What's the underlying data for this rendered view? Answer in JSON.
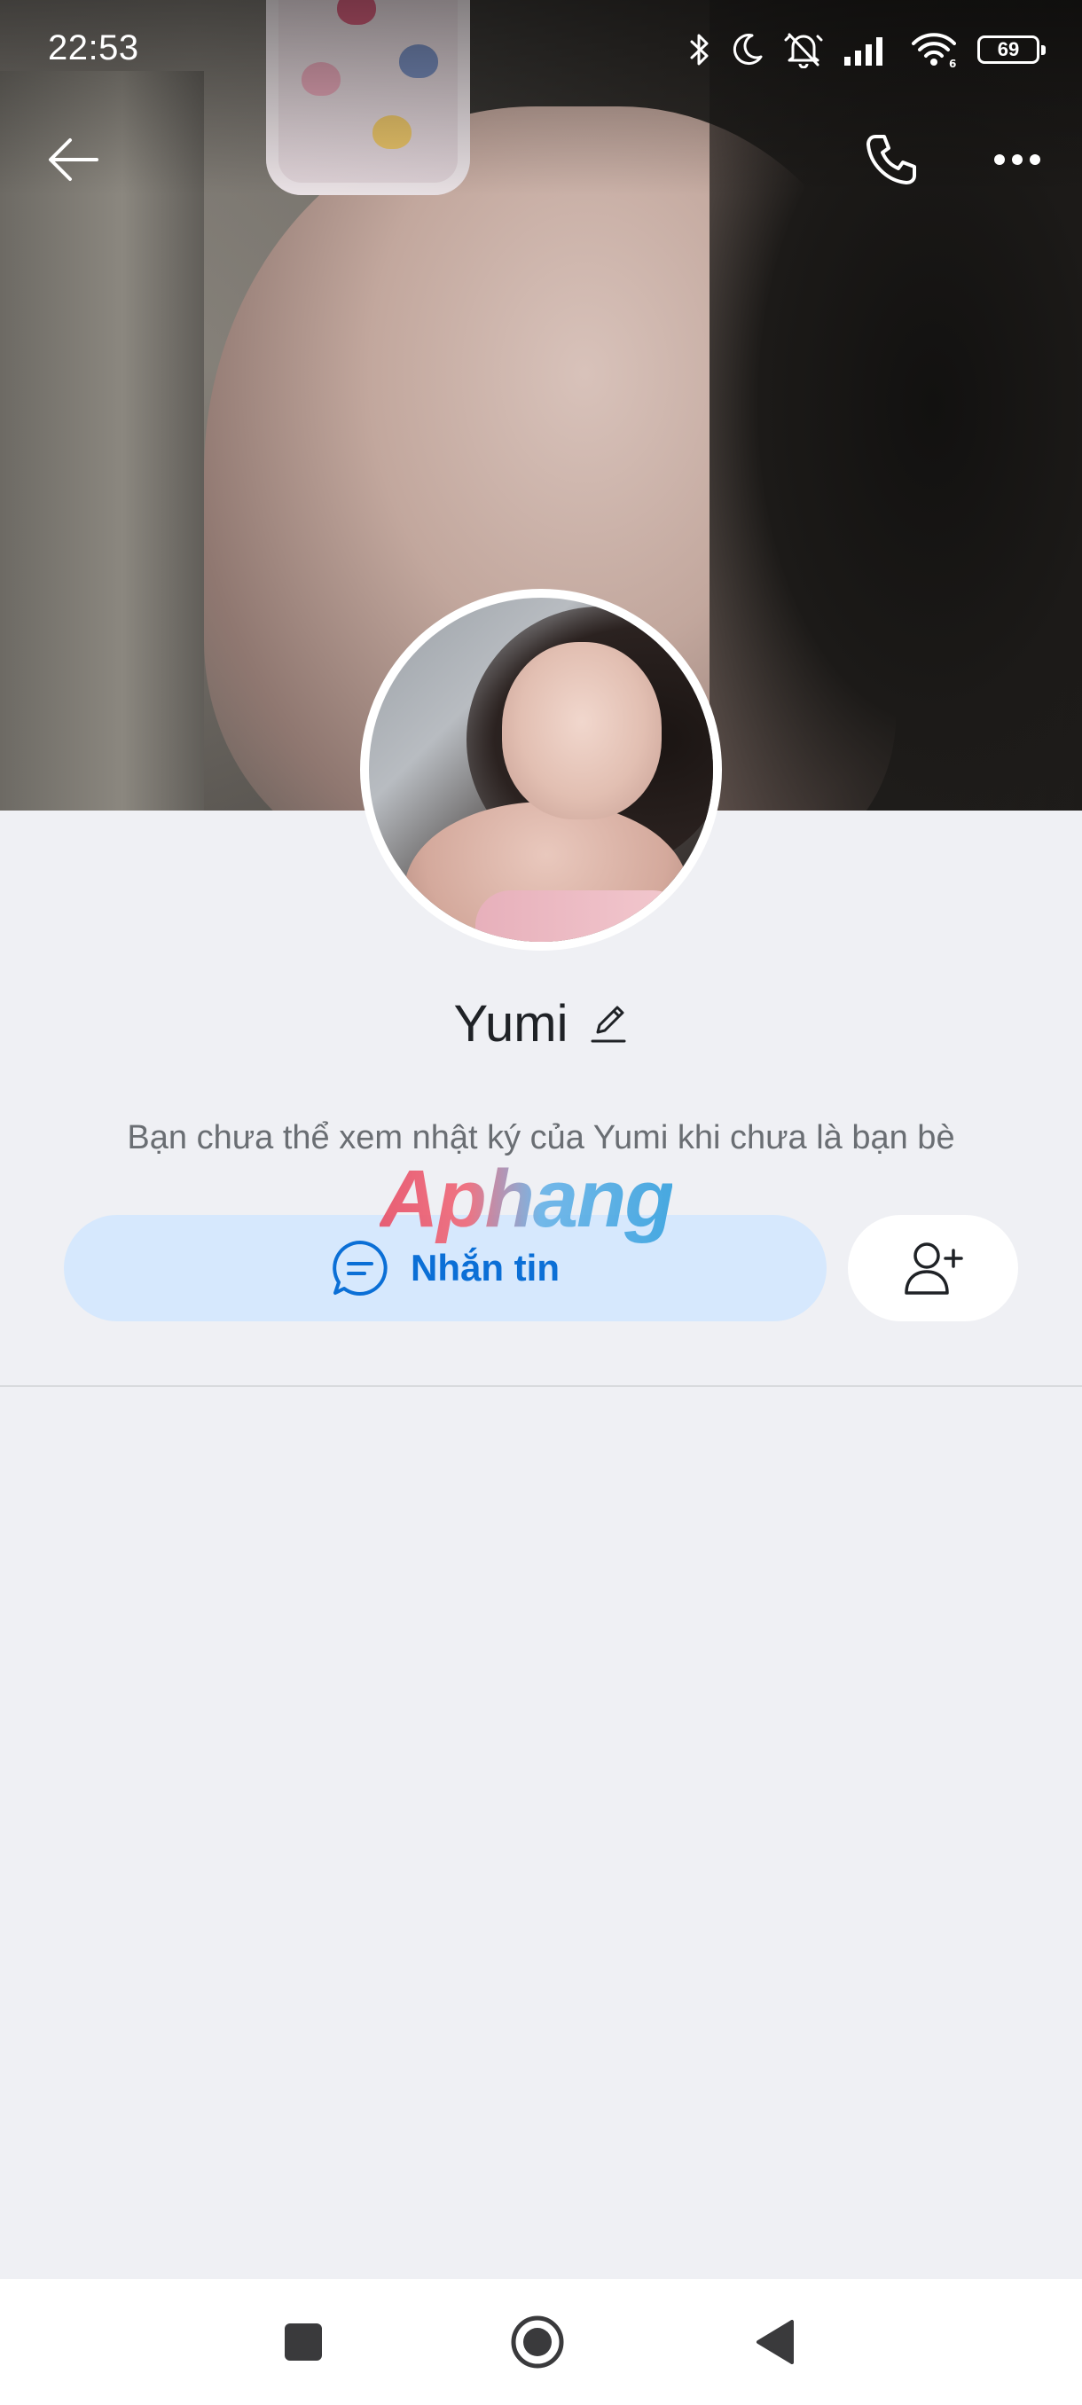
{
  "status_bar": {
    "time": "22:53",
    "battery_level": "69",
    "icons": [
      "bluetooth-icon",
      "do-not-disturb-moon-icon",
      "muted-bell-icon",
      "signal-icon",
      "wifi-6-icon",
      "battery-icon"
    ]
  },
  "top_bar": {
    "back_icon": "arrow-left-icon",
    "call_icon": "phone-icon",
    "more_icon": "more-horizontal-icon"
  },
  "profile": {
    "name": "Yumi",
    "edit_icon": "pencil-icon",
    "diary_note": "Bạn chưa thể xem nhật ký của Yumi khi chưa là bạn bè"
  },
  "actions": {
    "message_label": "Nhắn tin",
    "message_icon": "chat-bubble-icon",
    "add_friend_icon": "add-user-icon"
  },
  "watermark": {
    "text": "Aphang"
  },
  "colors": {
    "accent": "#0b6fd6",
    "message_button_bg": "#d6e8fd",
    "page_bg": "#eff0f4"
  },
  "nav_bar": {
    "icons": [
      "recents-square-icon",
      "home-circle-icon",
      "back-triangle-icon"
    ]
  }
}
